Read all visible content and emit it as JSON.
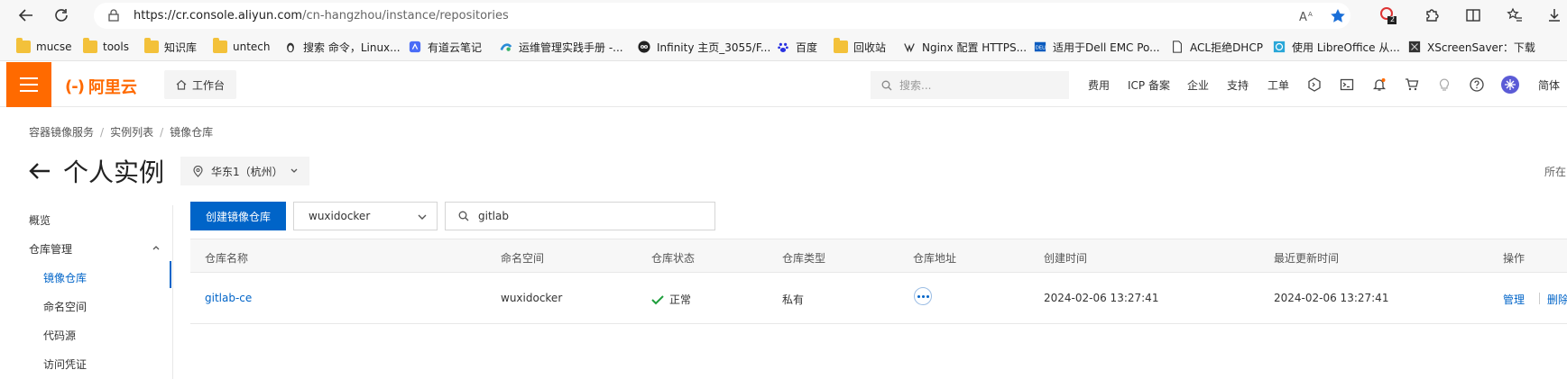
{
  "browser": {
    "url_host": "https://cr.console.aliyun.com",
    "url_path": "/cn-hangzhou/instance/repositories",
    "extensions_badge": "2",
    "bookmarks": [
      {
        "label": "mucse",
        "icon": "folder-icon"
      },
      {
        "label": "tools",
        "icon": "folder-icon"
      },
      {
        "label": "知识库",
        "icon": "folder-icon"
      },
      {
        "label": "untech",
        "icon": "folder-icon"
      },
      {
        "label": "搜索 命令，Linux...",
        "icon": "linux-penguin-icon"
      },
      {
        "label": "有道云笔记",
        "icon": "youdao-note-icon"
      },
      {
        "label": "运维管理实践手册 -...",
        "icon": "ops-manual-icon"
      },
      {
        "label": "Infinity 主页_3055/F...",
        "icon": "infinity-icon"
      },
      {
        "label": "百度",
        "icon": "baidu-paw-icon"
      },
      {
        "label": "回收站",
        "icon": "folder-icon"
      },
      {
        "label": "Nginx 配置 HTTPS...",
        "icon": "nginx-icon"
      },
      {
        "label": "适用于Dell EMC Po...",
        "icon": "dell-icon"
      },
      {
        "label": "ACL拒绝DHCP",
        "icon": "document-icon"
      },
      {
        "label": "使用 LibreOffice 从...",
        "icon": "libreoffice-icon"
      },
      {
        "label": "XScreenSaver：下载",
        "icon": "xscreensaver-icon"
      }
    ]
  },
  "topbar": {
    "logo_text": "阿里云",
    "workbench_label": "工作台",
    "search_placeholder": "搜索...",
    "links": [
      "费用",
      "ICP 备案",
      "企业",
      "支持",
      "工单"
    ],
    "language": "简体",
    "accent_color": "#ff6a00"
  },
  "breadcrumb": [
    "容器镜像服务",
    "实例列表",
    "镜像仓库"
  ],
  "page": {
    "title": "个人实例",
    "region": "华东1（杭州）",
    "right_text": "所在"
  },
  "sidenav": {
    "overview": "概览",
    "repo_group": "仓库管理",
    "items": [
      "镜像仓库",
      "命名空间",
      "代码源",
      "访问凭证"
    ],
    "active_index": 0
  },
  "toolbar": {
    "create_button": "创建镜像仓库",
    "namespace_value": "wuxidocker",
    "search_value": "gitlab"
  },
  "table": {
    "columns": [
      "仓库名称",
      "命名空间",
      "仓库状态",
      "仓库类型",
      "仓库地址",
      "创建时间",
      "最近更新时间",
      "操作"
    ],
    "rows": [
      {
        "name": "gitlab-ce",
        "namespace": "wuxidocker",
        "status": "正常",
        "type": "私有",
        "created": "2024-02-06 13:27:41",
        "updated": "2024-02-06 13:27:41",
        "action_manage": "管理",
        "action_delete": "删除"
      }
    ]
  },
  "colors": {
    "primary": "#0064c8",
    "success": "#1e9e3c",
    "brand": "#ff6a00"
  }
}
